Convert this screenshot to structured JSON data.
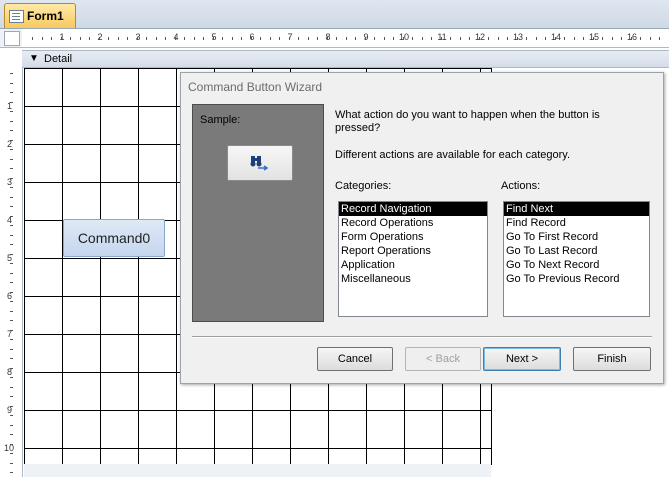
{
  "tab": {
    "label": "Form1",
    "icon": "form-icon"
  },
  "ruler": {
    "labels": [
      "1",
      "2",
      "3",
      "4",
      "5",
      "6",
      "7",
      "8",
      "9",
      "10",
      "11",
      "12",
      "13",
      "14",
      "15",
      "16"
    ]
  },
  "vruler": {
    "labels": [
      "1",
      "2",
      "3",
      "4",
      "5",
      "6",
      "7",
      "8",
      "9",
      "10"
    ]
  },
  "section": {
    "label": "Detail",
    "icon": "section-collapse-icon"
  },
  "design_button": {
    "label": "Command0"
  },
  "wizard": {
    "title": "Command Button Wizard",
    "sample_label": "Sample:",
    "sample_icon": "binoculars-find-icon",
    "question": "What action do you want to happen when the button is pressed?",
    "note": "Different actions are available for each category.",
    "categories_label": "Categories:",
    "actions_label": "Actions:",
    "categories": [
      "Record Navigation",
      "Record Operations",
      "Form Operations",
      "Report Operations",
      "Application",
      "Miscellaneous"
    ],
    "actions": [
      "Find Next",
      "Find Record",
      "Go To First Record",
      "Go To Last Record",
      "Go To Next Record",
      "Go To Previous Record"
    ],
    "selected_category": "Record Navigation",
    "selected_action": "Find Next",
    "buttons": {
      "cancel": "Cancel",
      "back": "< Back",
      "next": "Next >",
      "finish": "Finish"
    }
  }
}
